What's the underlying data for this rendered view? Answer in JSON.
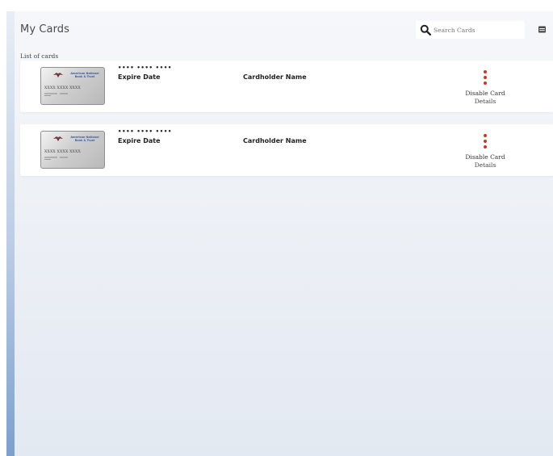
{
  "header": {
    "title": "My Cards",
    "search": {
      "placeholder": "Search Cards",
      "value": ""
    },
    "search_icon": "search-icon",
    "menu_icon": "menu-icon"
  },
  "list_label": "List of cards",
  "cards": [
    {
      "card_image": {
        "bank_line1": "American National",
        "bank_line2": "Bank & Trust",
        "number": "XXXX XXXX XXXX"
      },
      "masked_number": "•••• •••• ••••",
      "expire_label": "Expire Date",
      "holder_label": "Cardholder Name",
      "actions": {
        "disable": "Disable Card",
        "details": "Details"
      }
    },
    {
      "card_image": {
        "bank_line1": "American National",
        "bank_line2": "Bank & Trust",
        "number": "XXXX XXXX XXXX"
      },
      "masked_number": "•••• •••• ••••",
      "expire_label": "Expire Date",
      "holder_label": "Cardholder Name",
      "actions": {
        "disable": "Disable Card",
        "details": "Details"
      }
    }
  ],
  "colors": {
    "accent_dots": "#c0392b",
    "bank_text": "#3b5ea6",
    "rail": "#7e9fcc"
  }
}
